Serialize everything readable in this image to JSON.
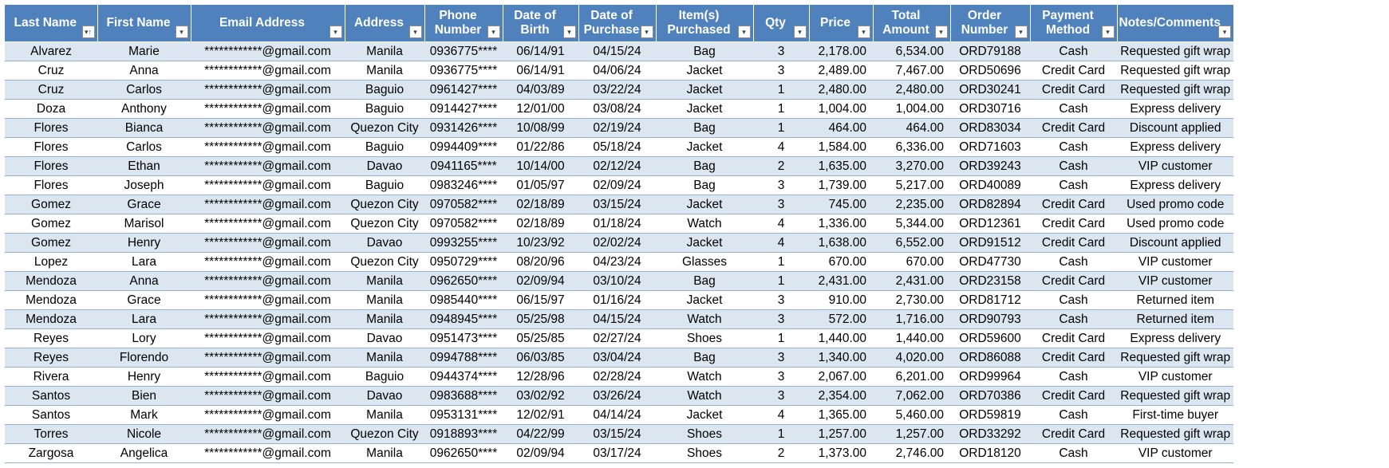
{
  "columns": [
    {
      "key": "last_name",
      "label": "Last Name",
      "filter_icon": "sort-asc-filter-icon"
    },
    {
      "key": "first_name",
      "label": "First Name",
      "filter_icon": "filter-dropdown-icon"
    },
    {
      "key": "email",
      "label": "Email Address",
      "filter_icon": "filter-dropdown-icon"
    },
    {
      "key": "address",
      "label": "Address",
      "filter_icon": "filter-dropdown-icon"
    },
    {
      "key": "phone",
      "label": "Phone Number",
      "filter_icon": "filter-dropdown-icon"
    },
    {
      "key": "dob",
      "label": "Date of Birth",
      "filter_icon": "filter-dropdown-icon"
    },
    {
      "key": "dop",
      "label": "Date of Purchase",
      "filter_icon": "filter-dropdown-icon"
    },
    {
      "key": "item",
      "label": "Item(s) Purchased",
      "filter_icon": "filter-dropdown-icon"
    },
    {
      "key": "qty",
      "label": "Qty",
      "filter_icon": "filter-dropdown-icon"
    },
    {
      "key": "price",
      "label": "Price",
      "filter_icon": "filter-dropdown-icon"
    },
    {
      "key": "total",
      "label": "Total Amount",
      "filter_icon": "filter-dropdown-icon"
    },
    {
      "key": "order",
      "label": "Order Number",
      "filter_icon": "filter-dropdown-icon"
    },
    {
      "key": "payment",
      "label": "Payment Method",
      "filter_icon": "filter-dropdown-icon"
    },
    {
      "key": "notes",
      "label": "Notes/Comments",
      "filter_icon": "filter-dropdown-icon"
    }
  ],
  "rows": [
    [
      "Alvarez",
      "Marie",
      "************@gmail.com",
      "Manila",
      "0936775****",
      "06/14/91",
      "04/15/24",
      "Bag",
      "3",
      "2,178.00",
      "6,534.00",
      "ORD79188",
      "Cash",
      "Requested gift wrap"
    ],
    [
      "Cruz",
      "Anna",
      "************@gmail.com",
      "Manila",
      "0936775****",
      "06/14/91",
      "04/06/24",
      "Jacket",
      "3",
      "2,489.00",
      "7,467.00",
      "ORD50696",
      "Credit Card",
      "Requested gift wrap"
    ],
    [
      "Cruz",
      "Carlos",
      "************@gmail.com",
      "Baguio",
      "0961427****",
      "04/03/89",
      "03/22/24",
      "Jacket",
      "1",
      "2,480.00",
      "2,480.00",
      "ORD30241",
      "Credit Card",
      "Requested gift wrap"
    ],
    [
      "Doza",
      "Anthony",
      "************@gmail.com",
      "Baguio",
      "0914427****",
      "12/01/00",
      "03/08/24",
      "Jacket",
      "1",
      "1,004.00",
      "1,004.00",
      "ORD30716",
      "Cash",
      "Express delivery"
    ],
    [
      "Flores",
      "Bianca",
      "************@gmail.com",
      "Quezon City",
      "0931426****",
      "10/08/99",
      "02/19/24",
      "Bag",
      "1",
      "464.00",
      "464.00",
      "ORD83034",
      "Credit Card",
      "Discount applied"
    ],
    [
      "Flores",
      "Carlos",
      "************@gmail.com",
      "Baguio",
      "0994409****",
      "01/22/86",
      "05/18/24",
      "Jacket",
      "4",
      "1,584.00",
      "6,336.00",
      "ORD71603",
      "Cash",
      "Express delivery"
    ],
    [
      "Flores",
      "Ethan",
      "************@gmail.com",
      "Davao",
      "0941165****",
      "10/14/00",
      "02/12/24",
      "Bag",
      "2",
      "1,635.00",
      "3,270.00",
      "ORD39243",
      "Cash",
      "VIP customer"
    ],
    [
      "Flores",
      "Joseph",
      "************@gmail.com",
      "Baguio",
      "0983246****",
      "01/05/97",
      "02/09/24",
      "Bag",
      "3",
      "1,739.00",
      "5,217.00",
      "ORD40089",
      "Cash",
      "Express delivery"
    ],
    [
      "Gomez",
      "Grace",
      "************@gmail.com",
      "Quezon City",
      "0970582****",
      "02/18/89",
      "03/15/24",
      "Jacket",
      "3",
      "745.00",
      "2,235.00",
      "ORD82894",
      "Credit Card",
      "Used promo code"
    ],
    [
      "Gomez",
      "Marisol",
      "************@gmail.com",
      "Quezon City",
      "0970582****",
      "02/18/89",
      "01/18/24",
      "Watch",
      "4",
      "1,336.00",
      "5,344.00",
      "ORD12361",
      "Credit Card",
      "Used promo code"
    ],
    [
      "Gomez",
      "Henry",
      "************@gmail.com",
      "Davao",
      "0993255****",
      "10/23/92",
      "02/02/24",
      "Jacket",
      "4",
      "1,638.00",
      "6,552.00",
      "ORD91512",
      "Credit Card",
      "Discount applied"
    ],
    [
      "Lopez",
      "Lara",
      "************@gmail.com",
      "Quezon City",
      "0950729****",
      "08/20/96",
      "04/23/24",
      "Glasses",
      "1",
      "670.00",
      "670.00",
      "ORD47730",
      "Cash",
      "VIP customer"
    ],
    [
      "Mendoza",
      "Anna",
      "************@gmail.com",
      "Manila",
      "0962650****",
      "02/09/94",
      "03/10/24",
      "Bag",
      "1",
      "2,431.00",
      "2,431.00",
      "ORD23158",
      "Credit Card",
      "VIP customer"
    ],
    [
      "Mendoza",
      "Grace",
      "************@gmail.com",
      "Manila",
      "0985440****",
      "06/15/97",
      "01/16/24",
      "Jacket",
      "3",
      "910.00",
      "2,730.00",
      "ORD81712",
      "Cash",
      "Returned item"
    ],
    [
      "Mendoza",
      "Lara",
      "************@gmail.com",
      "Manila",
      "0948945****",
      "05/25/98",
      "04/15/24",
      "Watch",
      "3",
      "572.00",
      "1,716.00",
      "ORD90793",
      "Cash",
      "Returned item"
    ],
    [
      "Reyes",
      "Lory",
      "************@gmail.com",
      "Davao",
      "0951473****",
      "05/25/85",
      "02/27/24",
      "Shoes",
      "1",
      "1,440.00",
      "1,440.00",
      "ORD59600",
      "Credit Card",
      "Express delivery"
    ],
    [
      "Reyes",
      "Florendo",
      "************@gmail.com",
      "Manila",
      "0994788****",
      "06/03/85",
      "03/04/24",
      "Bag",
      "3",
      "1,340.00",
      "4,020.00",
      "ORD86088",
      "Credit Card",
      "Requested gift wrap"
    ],
    [
      "Rivera",
      "Henry",
      "************@gmail.com",
      "Baguio",
      "0944374****",
      "12/28/96",
      "02/28/24",
      "Watch",
      "3",
      "2,067.00",
      "6,201.00",
      "ORD99964",
      "Cash",
      "VIP customer"
    ],
    [
      "Santos",
      "Bien",
      "************@gmail.com",
      "Davao",
      "0983688****",
      "03/02/92",
      "03/26/24",
      "Watch",
      "3",
      "2,354.00",
      "7,062.00",
      "ORD70386",
      "Credit Card",
      "Requested gift wrap"
    ],
    [
      "Santos",
      "Mark",
      "************@gmail.com",
      "Manila",
      "0953131****",
      "12/02/91",
      "04/14/24",
      "Jacket",
      "4",
      "1,365.00",
      "5,460.00",
      "ORD59819",
      "Cash",
      "First-time buyer"
    ],
    [
      "Torres",
      "Nicole",
      "************@gmail.com",
      "Quezon City",
      "0918893****",
      "04/22/99",
      "03/15/24",
      "Shoes",
      "1",
      "1,257.00",
      "1,257.00",
      "ORD33292",
      "Credit Card",
      "Requested gift wrap"
    ],
    [
      "Zargosa",
      "Angelica",
      "************@gmail.com",
      "Manila",
      "0962650****",
      "02/09/94",
      "03/17/24",
      "Shoes",
      "2",
      "1,373.00",
      "2,746.00",
      "ORD18120",
      "Cash",
      "VIP customer"
    ]
  ],
  "colors": {
    "header_bg": "#4f81bd",
    "header_text": "#ffffff",
    "band_row": "#dce6f1",
    "plain_row": "#ffffff",
    "row_border": "#95b3d7"
  }
}
